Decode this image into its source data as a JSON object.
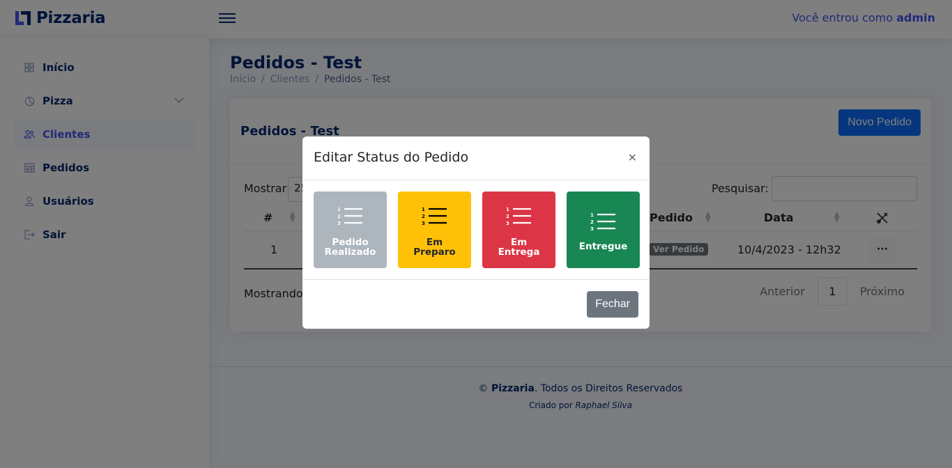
{
  "header": {
    "logo_text": "Pizzaria",
    "user_prefix": "Você entrou como",
    "user_name": "admin"
  },
  "sidebar": {
    "items": [
      {
        "label": "Início",
        "icon": "grid-icon"
      },
      {
        "label": "Pizza",
        "icon": "pie-chart-icon"
      },
      {
        "label": "Clientes",
        "icon": "people-icon"
      },
      {
        "label": "Pedidos",
        "icon": "table-icon"
      },
      {
        "label": "Usuários",
        "icon": "person-icon"
      },
      {
        "label": "Sair",
        "icon": "logout-icon"
      }
    ]
  },
  "page": {
    "title": "Pedidos - Test",
    "breadcrumb": [
      "Início",
      "/",
      "Clientes",
      "/",
      "Pedidos - Test"
    ]
  },
  "card": {
    "title": "Pedidos - Test",
    "new_button": "Novo Pedido",
    "show_label": "Mostrar",
    "show_value": "25",
    "search_label": "Pesquisar:",
    "columns": [
      "#",
      "Pedido",
      "Data"
    ],
    "rows": [
      {
        "num": "1",
        "badge": "Ver Pedido",
        "date": "10/4/2023 - 12h32",
        "actions": "···"
      }
    ],
    "info_text": "Mostrando",
    "pager": {
      "prev": "Anterior",
      "current": "1",
      "next": "Próximo"
    }
  },
  "footer": {
    "copyright": "©",
    "brand": "Pizzaria",
    "rights": ". Todos os Direitos Reservados",
    "created_prefix": "Criado por",
    "author": "Raphael Silva"
  },
  "modal": {
    "title": "Editar Status do Pedido",
    "close_glyph": "×",
    "tiles": [
      {
        "line1": "Pedido",
        "line2": "Realizado",
        "color": "#adb5bd"
      },
      {
        "line1": "Em",
        "line2": "Preparo",
        "color": "#ffc107"
      },
      {
        "line1": "Em",
        "line2": "Entrega",
        "color": "#dc3545"
      },
      {
        "line1": "Entregue",
        "line2": "",
        "color": "#198754"
      }
    ],
    "close_button": "Fechar"
  }
}
